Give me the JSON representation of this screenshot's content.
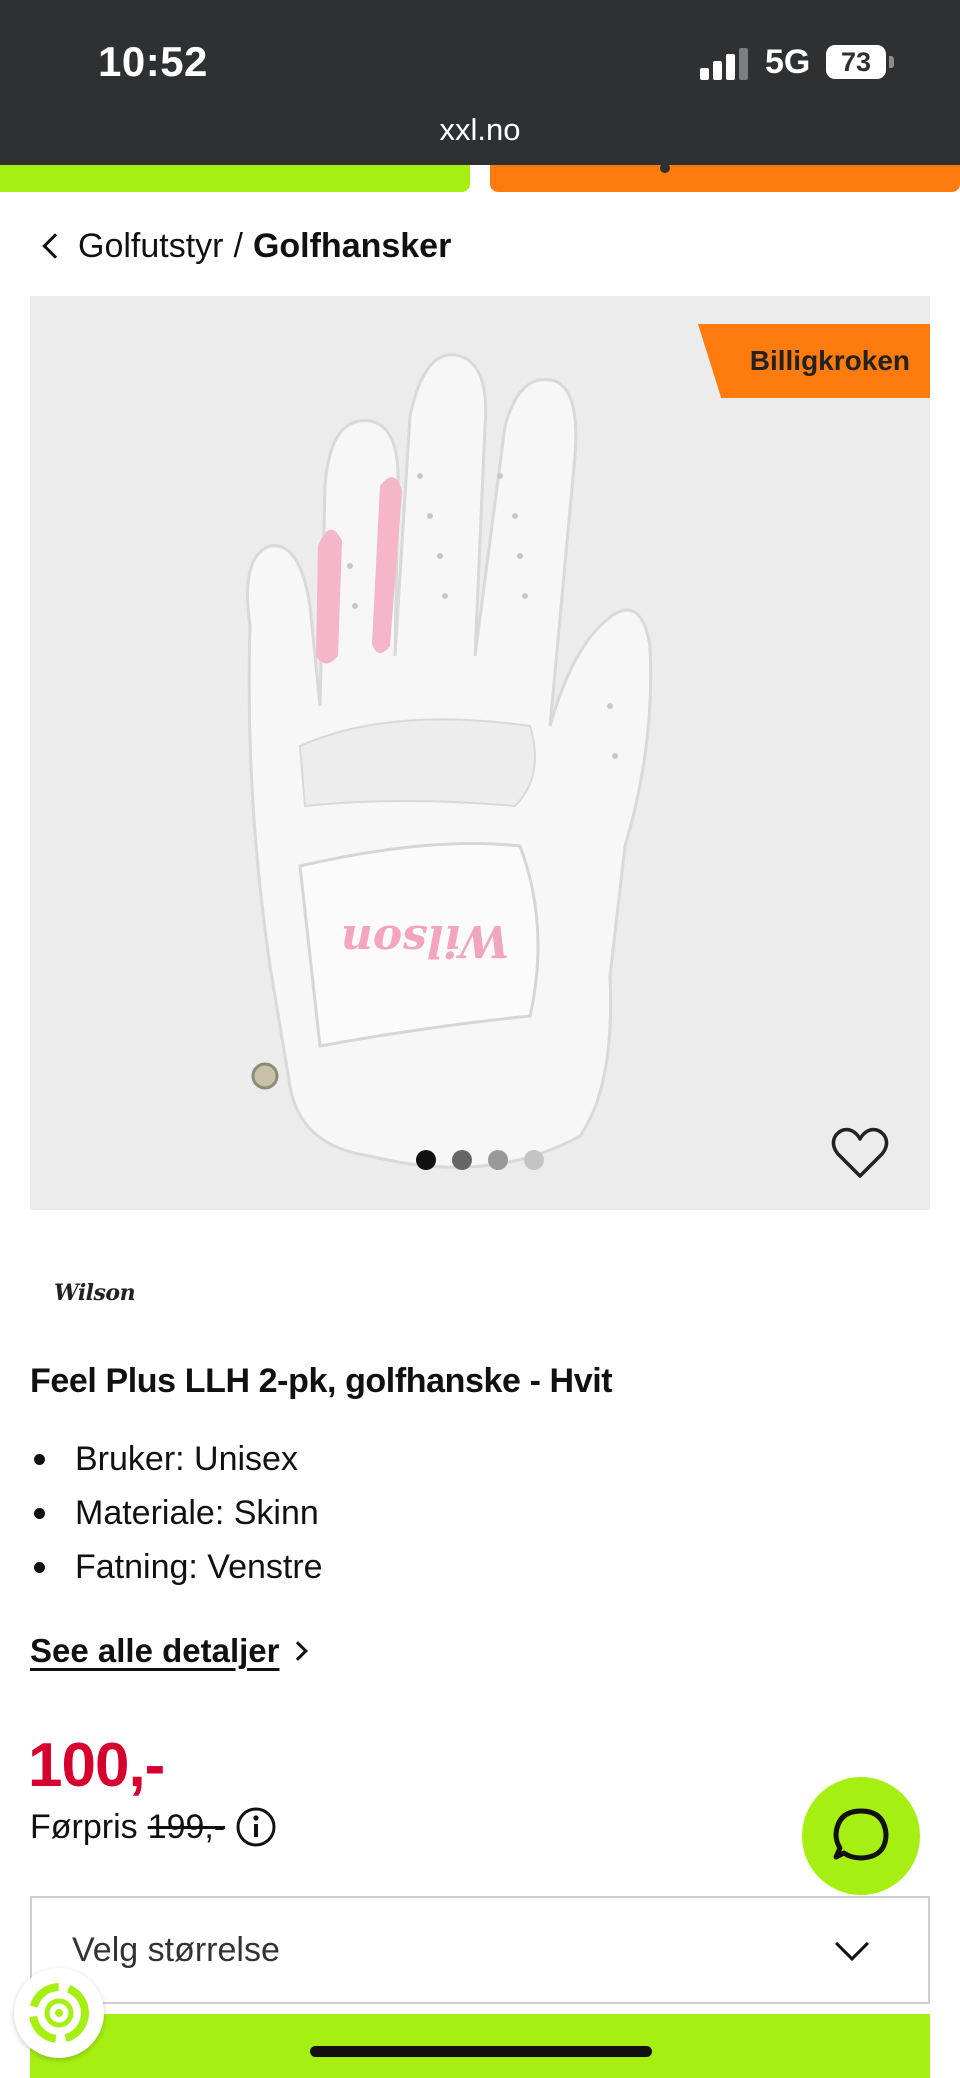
{
  "status_bar": {
    "time": "10:52",
    "network": "5G",
    "battery": "73",
    "url": "xxl.no"
  },
  "breadcrumb": {
    "parent": "Golfutstyr",
    "separator": "/",
    "current": "Golfhansker"
  },
  "gallery": {
    "badge": "Billigkroken",
    "image_count": 4,
    "active_index": 0,
    "favorite_icon": "heart-outline-icon"
  },
  "product": {
    "brand": "Wilson",
    "title": "Feel Plus LLH 2-pk, golfhanske - Hvit",
    "specs": [
      "Bruker: Unisex",
      "Materiale: Skinn",
      "Fatning: Venstre"
    ],
    "details_link": "See alle detaljer",
    "price": "100,-",
    "previous_price_label": "Førpris",
    "previous_price": "199,-"
  },
  "size_select": {
    "placeholder": "Velg størrelse"
  },
  "colors": {
    "accent_green": "#a6ef12",
    "accent_orange": "#ff7b0d",
    "price_red": "#d6002f",
    "status_bar": "#2e3032"
  }
}
